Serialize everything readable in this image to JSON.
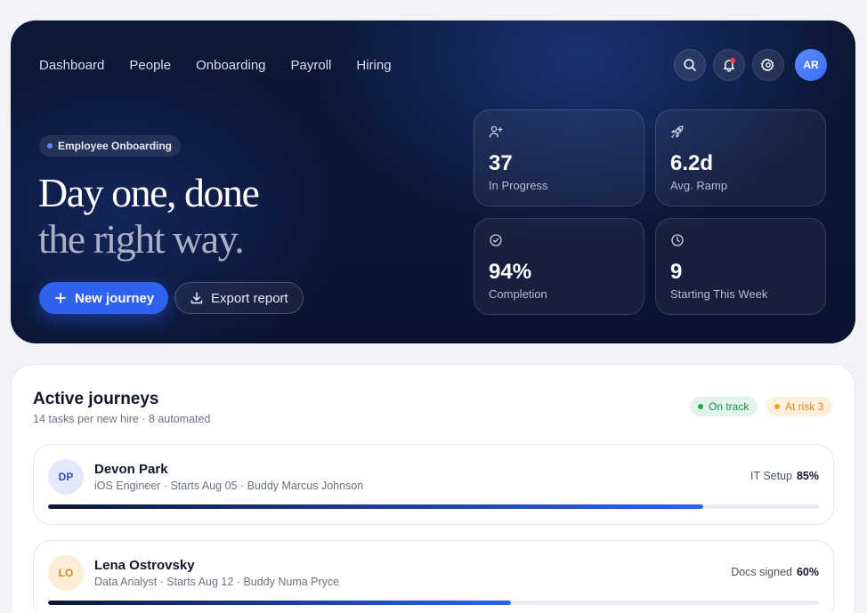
{
  "nav": {
    "items": [
      "Dashboard",
      "People",
      "Onboarding",
      "Payroll",
      "Hiring"
    ]
  },
  "header_icons": {
    "search": "search-icon",
    "notifications": "bell-icon",
    "settings": "gear-icon"
  },
  "user": {
    "initials": "AR"
  },
  "hero": {
    "badge": "Employee Onboarding",
    "headline_line1": "Day one, done",
    "headline_line2": "the right way.",
    "primary_button": "New journey",
    "secondary_button": "Export report"
  },
  "stats": [
    {
      "icon": "user-plus-icon",
      "value": "37",
      "label": "In Progress"
    },
    {
      "icon": "rocket-icon",
      "value": "6.2d",
      "label": "Avg. Ramp"
    },
    {
      "icon": "check-circle-icon",
      "value": "94%",
      "label": "Completion"
    },
    {
      "icon": "clock-icon",
      "value": "9",
      "label": "Starting This Week"
    }
  ],
  "journeys": {
    "title": "Active journeys",
    "subtitle": "14 tasks per new hire · 8 automated",
    "on_track": "On track",
    "at_risk": "At risk 3",
    "rows": [
      {
        "initials": "DP",
        "name": "Devon Park",
        "meta": "iOS Engineer · Starts Aug 05 · Buddy Marcus Johnson",
        "stage": "IT Setup",
        "percent_label": "85%",
        "progress": 0.85,
        "avatar_bg": "#e3e9fb",
        "avatar_fg": "#2f4fb8"
      },
      {
        "initials": "LO",
        "name": "Lena Ostrovsky",
        "meta": "Data Analyst · Starts Aug 12 · Buddy Numa Pryce",
        "stage": "Docs signed",
        "percent_label": "60%",
        "progress": 0.6,
        "avatar_bg": "#fdecd6",
        "avatar_fg": "#d48a1a"
      }
    ]
  },
  "colors": {
    "accent": "#2f63ee",
    "hero_bg": "#0b1636",
    "on_track": "#22a35a",
    "at_risk": "#f29d25"
  }
}
